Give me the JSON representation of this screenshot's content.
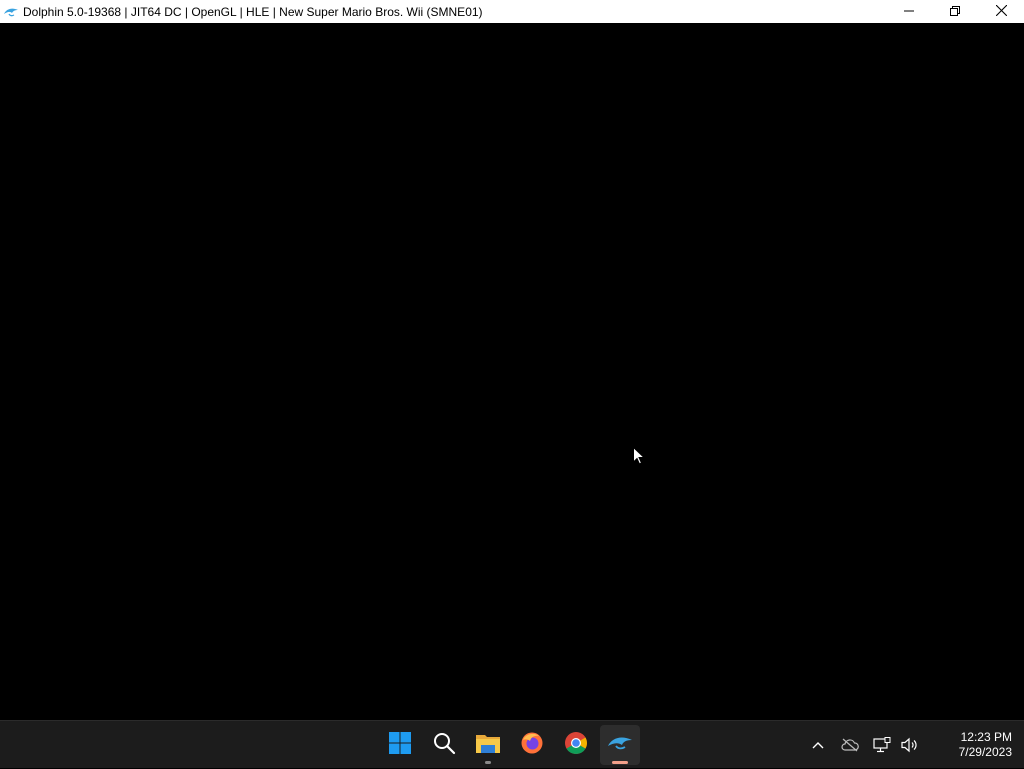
{
  "window": {
    "title": "Dolphin 5.0-19368 | JIT64 DC | OpenGL | HLE | New Super Mario Bros. Wii (SMNE01)",
    "app_icon": "dolphin-icon",
    "controls": {
      "minimize_icon": "minimize-icon",
      "restore_icon": "restore-icon",
      "close_icon": "close-icon"
    }
  },
  "taskbar": {
    "pinned": [
      {
        "name": "start",
        "icon": "windows-start-icon"
      },
      {
        "name": "search",
        "icon": "search-icon"
      },
      {
        "name": "file-explorer",
        "icon": "folder-icon",
        "running": true
      },
      {
        "name": "firefox",
        "icon": "firefox-icon"
      },
      {
        "name": "chrome",
        "icon": "chrome-icon"
      },
      {
        "name": "dolphin",
        "icon": "dolphin-icon",
        "active": true
      }
    ],
    "tray": {
      "icons": [
        "chevron-up-icon",
        "cloud-offline-icon",
        "network-icon",
        "volume-icon"
      ],
      "time": "12:23 PM",
      "date": "7/29/2023"
    }
  },
  "colors": {
    "titlebar_bg": "#ffffff",
    "game_bg": "#000000",
    "taskbar_bg": "#1c1c1c",
    "active_indicator": "#f2a08a",
    "running_indicator": "#8a8a8a",
    "windows_blue": "#1e9bf0",
    "dolphin_blue": "#3aa3e0"
  }
}
